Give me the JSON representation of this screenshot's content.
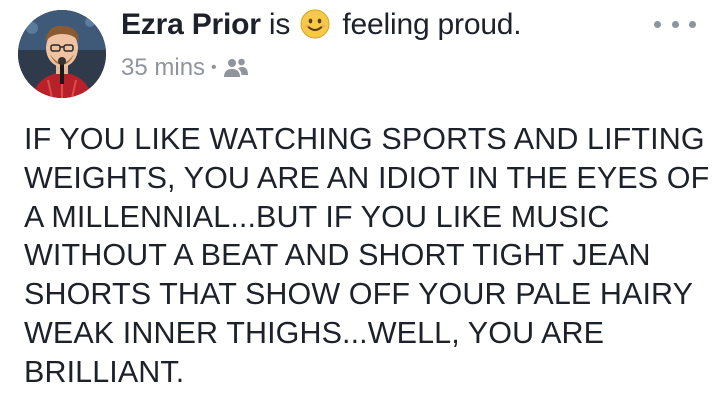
{
  "post": {
    "author_name": "Ezra Prior",
    "is_word": "is",
    "feeling_text": "feeling proud.",
    "feeling_icon": "smiley-emoji-icon",
    "timestamp": "35 mins",
    "separator": "•",
    "audience_icon": "friends-icon",
    "more_icon": "more-options-icon",
    "body_lines": [
      "IF YOU LIKE WATCHING SPORTS AND LIFTING",
      "WEIGHTS, YOU ARE AN IDIOT IN THE EYES OF",
      "A MILLENNIAL...BUT IF YOU LIKE MUSIC",
      "WITHOUT A BEAT AND SHORT TIGHT JEAN",
      "SHORTS THAT SHOW OFF YOUR PALE HAIRY",
      "WEAK INNER THIGHS...WELL, YOU ARE",
      "BRILLIANT."
    ]
  },
  "colors": {
    "text": "#1d2129",
    "meta": "#90949c",
    "emoji_yellow": "#f7c948"
  }
}
